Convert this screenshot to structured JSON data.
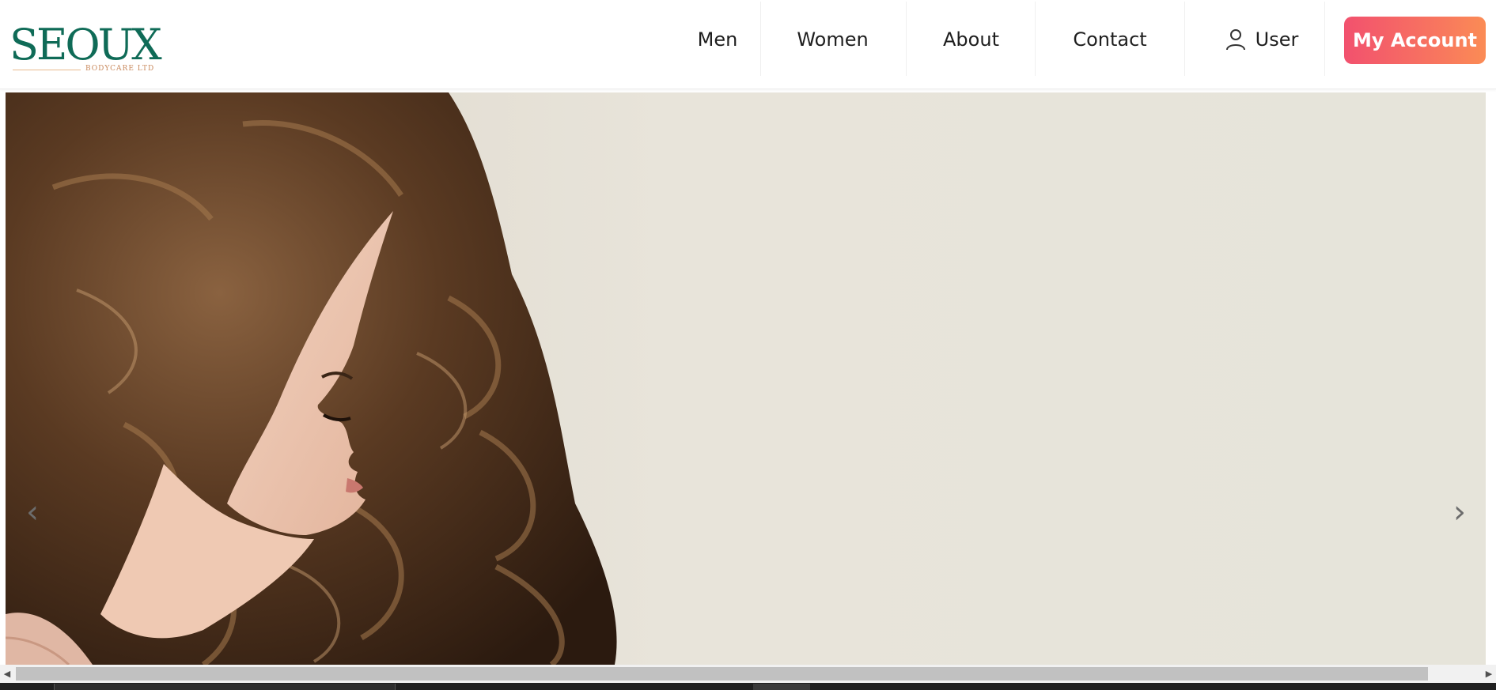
{
  "logo": {
    "main": "SEOUX",
    "sub": "BODYCARE LTD"
  },
  "nav": {
    "items": [
      {
        "label": "Men"
      },
      {
        "label": "Women"
      },
      {
        "label": "About"
      },
      {
        "label": "Contact"
      }
    ],
    "user_label": "User",
    "account_label": "My Account"
  },
  "hero": {
    "prev_symbol": "‹",
    "next_symbol": "›",
    "image": "woman-with-long-curly-brown-hair-profile"
  },
  "scrollbar": {
    "left_symbol": "◀",
    "right_symbol": "▶"
  },
  "colors": {
    "brand_green": "#0f6b57",
    "brand_gold": "#c98a5e",
    "accent_start": "#f2516e",
    "accent_end": "#fb8c55",
    "hero_background": "#e9e5dc"
  }
}
